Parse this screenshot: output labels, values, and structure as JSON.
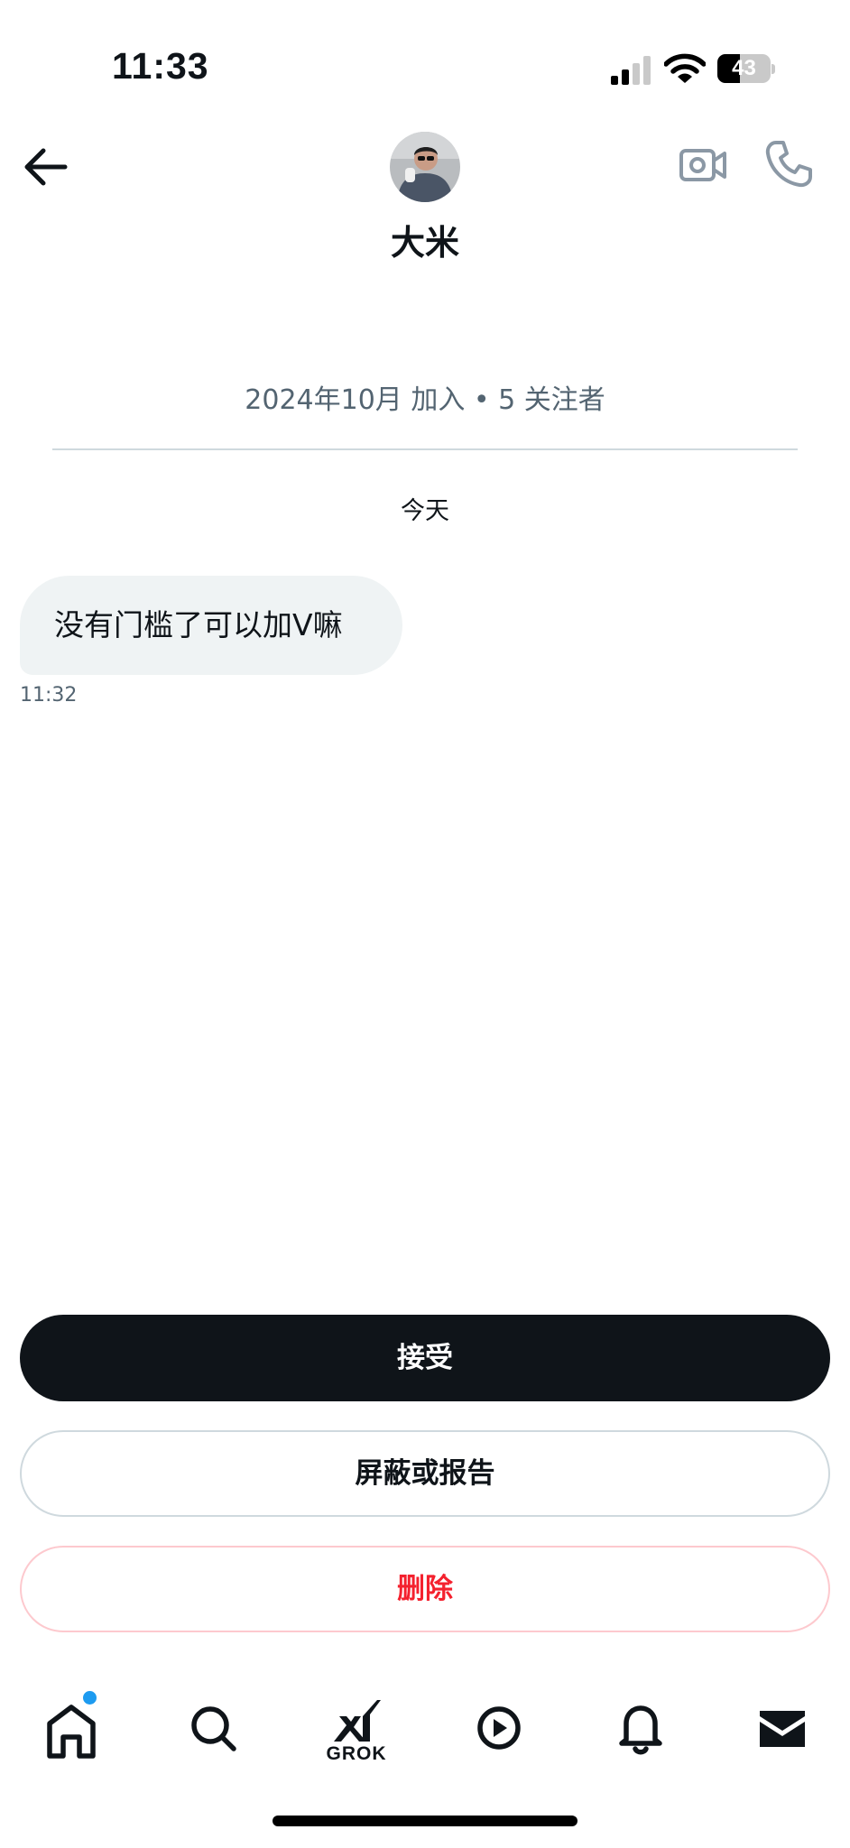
{
  "status_bar": {
    "time": "11:33",
    "battery": 43,
    "battery_label": "43"
  },
  "header": {
    "contact_name": "大米",
    "back_icon": "arrow-left-icon",
    "video_icon": "video-camera-icon",
    "phone_icon": "phone-icon"
  },
  "conversation": {
    "profile_meta": "2024年10月 加入 • 5 关注者",
    "date_separator": "今天",
    "messages": [
      {
        "text": "没有门槛了可以加V嘛",
        "time": "11:32"
      }
    ]
  },
  "actions": {
    "accept": "接受",
    "block_report": "屏蔽或报告",
    "delete": "删除"
  },
  "bottom_nav": {
    "items": [
      {
        "icon": "home-icon",
        "badge": true
      },
      {
        "icon": "search-icon"
      },
      {
        "icon": "grok-icon",
        "label": "GROK"
      },
      {
        "icon": "play-icon"
      },
      {
        "icon": "bell-icon"
      },
      {
        "icon": "mail-icon"
      }
    ]
  },
  "colors": {
    "primary_text": "#0f1419",
    "secondary_text": "#536471",
    "accent_blue": "#1d9bf0",
    "danger_red": "#f4212e",
    "bubble_bg": "#eff3f4"
  }
}
